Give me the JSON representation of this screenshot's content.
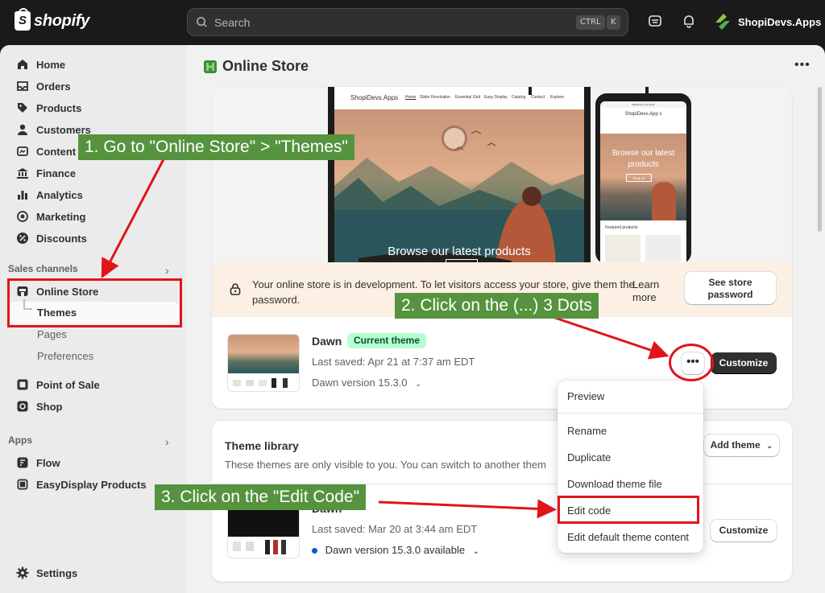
{
  "topbar": {
    "brand": "shopify",
    "search_placeholder": "Search",
    "shortcut_ctrl": "CTRL",
    "shortcut_key": "K",
    "store_name": "ShopiDevs.Apps"
  },
  "sidebar": {
    "items": [
      "Home",
      "Orders",
      "Products",
      "Customers",
      "Content",
      "Finance",
      "Analytics",
      "Marketing",
      "Discounts"
    ],
    "sales_channels_label": "Sales channels",
    "online_store": "Online Store",
    "themes": "Themes",
    "pages": "Pages",
    "preferences": "Preferences",
    "point_of_sale": "Point of Sale",
    "shop": "Shop",
    "apps_label": "Apps",
    "apps": [
      "Flow",
      "EasyDisplay Products"
    ],
    "settings": "Settings"
  },
  "page": {
    "title": "Online Store"
  },
  "preview": {
    "laptop_brand": "ShopiDevs.Apps",
    "laptop_nav": [
      "Home",
      "Slider Revolution",
      "Essential Grid",
      "Easy Display",
      "Catalog",
      "Contact",
      "Explore"
    ],
    "laptop_hero_text": "Browse our latest products",
    "phone_announcement": "Welcome to our store",
    "phone_brand": "ShopiDevs.App s",
    "phone_hero_text": "Browse our latest products",
    "phone_button": "Shop all",
    "phone_featured": "Featured products"
  },
  "dev_banner": {
    "text": "Your online store is in development. To let visitors access your store, give them the password.",
    "learn_more": "Learn more",
    "see_password": "See store password"
  },
  "current_theme": {
    "name": "Dawn",
    "badge": "Current theme",
    "last_saved": "Last saved: Apr 21 at 7:37 am EDT",
    "version": "Dawn version 15.3.0",
    "more_button": "•••",
    "customize": "Customize"
  },
  "menu": {
    "items": [
      "Preview",
      "Rename",
      "Duplicate",
      "Download theme file",
      "Edit code",
      "Edit default theme content"
    ]
  },
  "library": {
    "title": "Theme library",
    "description": "These themes are only visible to you. You can switch to another them",
    "description_tail": ".",
    "add_theme": "Add theme",
    "theme_name": "Dawn",
    "last_saved": "Last saved: Mar 20 at 3:44 am EDT",
    "version": "Dawn version 15.3.0 available",
    "customize": "Customize"
  },
  "annotations": {
    "step1": "1. Go to \"Online Store\" > \"Themes\"",
    "step2": "2. Click on the (...) 3 Dots",
    "step3": "3. Click on the \"Edit Code\""
  },
  "colors": {
    "topbar": "#1a1a1a",
    "callout_green": "#56933f",
    "annotation_red": "#e1141b",
    "badge_green": "#b4fed2"
  }
}
